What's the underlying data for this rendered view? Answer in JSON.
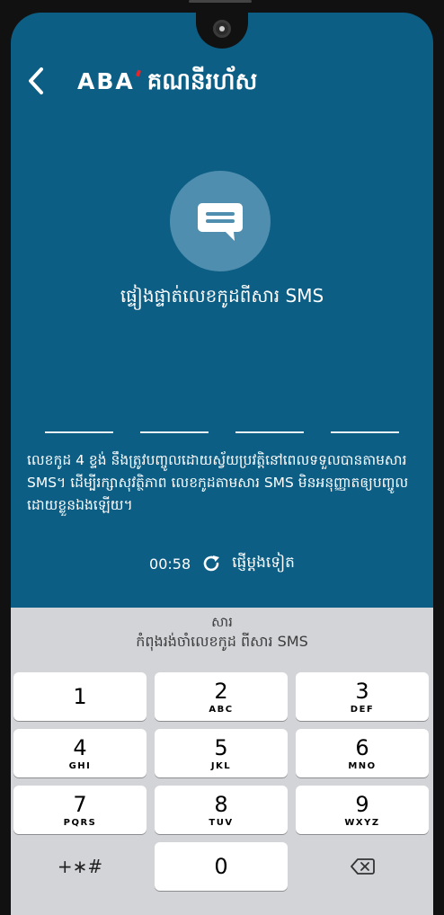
{
  "header": {
    "brand": "ABA",
    "title": "គណនីរហ័ស"
  },
  "verify": {
    "title": "ផ្ទៀងផ្ទាត់លេខកូដពីសារ SMS",
    "info": "លេខកូដ 4 ខ្ទង់ នឹងត្រូវបញ្ចូលដោយស្វ័យប្រវត្តិនៅពេលទទួលបានតាមសារ SMS។ ដើម្បីរក្សាសុវត្ថិភាព លេខកូដតាមសារ SMS មិនអនុញ្ញាតឲ្យបញ្ចូលដោយខ្លួនឯងឡើយ។",
    "timer": "00:58",
    "resend_label": "ផ្ញើម្តងទៀត"
  },
  "keyboard": {
    "suggestion_title": "សារ",
    "suggestion_text": "កំពុងរង់ចាំលេខកូដ ពីសារ SMS",
    "keys": [
      {
        "num": "1",
        "letters": ""
      },
      {
        "num": "2",
        "letters": "ABC"
      },
      {
        "num": "3",
        "letters": "DEF"
      },
      {
        "num": "4",
        "letters": "GHI"
      },
      {
        "num": "5",
        "letters": "JKL"
      },
      {
        "num": "6",
        "letters": "MNO"
      },
      {
        "num": "7",
        "letters": "PQRS"
      },
      {
        "num": "8",
        "letters": "TUV"
      },
      {
        "num": "9",
        "letters": "WXYZ"
      }
    ],
    "symbols_key": "+∗#",
    "zero_key": "0"
  },
  "icons": {
    "back": "chevron-left-icon",
    "message": "chat-bubble-icon",
    "refresh": "refresh-icon",
    "backspace": "backspace-icon"
  },
  "colors": {
    "screen_bg": "#0c5e85",
    "icon_circle": "#4f8eae",
    "brand_accent": "#e3262b",
    "keyboard_bg": "#d2d4d8"
  }
}
